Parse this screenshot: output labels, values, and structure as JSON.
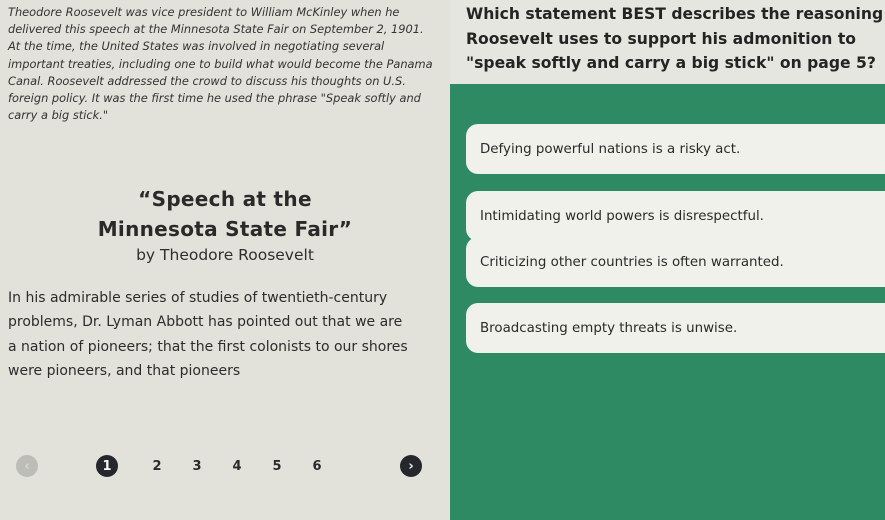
{
  "left": {
    "intro": "Theodore Roosevelt was vice president to William McKinley when he delivered this speech at the Minnesota State Fair on September 2, 1901. At the time, the United States was involved in negotiating several important treaties, including one to build what would become the Panama Canal. Roosevelt addressed the crowd to discuss his thoughts on U.S. foreign policy. It was the first time he used the phrase \"Speak softly and carry a big stick.\"",
    "title_line1": "“Speech at the",
    "title_line2": "Minnesota State Fair”",
    "byline": "by Theodore Roosevelt",
    "passage": "In his admirable series of studies of twentieth-century problems, Dr. Lyman Abbott has pointed out that we are a nation of pioneers; that the first colonists to our shores were pioneers, and that pioneers"
  },
  "pager": {
    "prev_icon": "chevron-left-icon",
    "next_icon": "chevron-right-icon",
    "prev_glyph": "‹",
    "next_glyph": "›",
    "pages": [
      "1",
      "2",
      "3",
      "4",
      "5",
      "6"
    ],
    "current": "1"
  },
  "question": {
    "text": "Which statement BEST describes the reasoning Roosevelt uses to support his admonition to \"speak softly and carry a big stick\" on page 5?"
  },
  "answers": [
    "Defying powerful nations is a risky act.",
    "Intimidating world powers is disrespectful.",
    "Criticizing other countries is often warranted.",
    "Broadcasting empty threats is unwise."
  ],
  "colors": {
    "accent_green": "#2e8a63",
    "answer_bg": "#f1f1ec",
    "dark_button": "#24282c"
  }
}
